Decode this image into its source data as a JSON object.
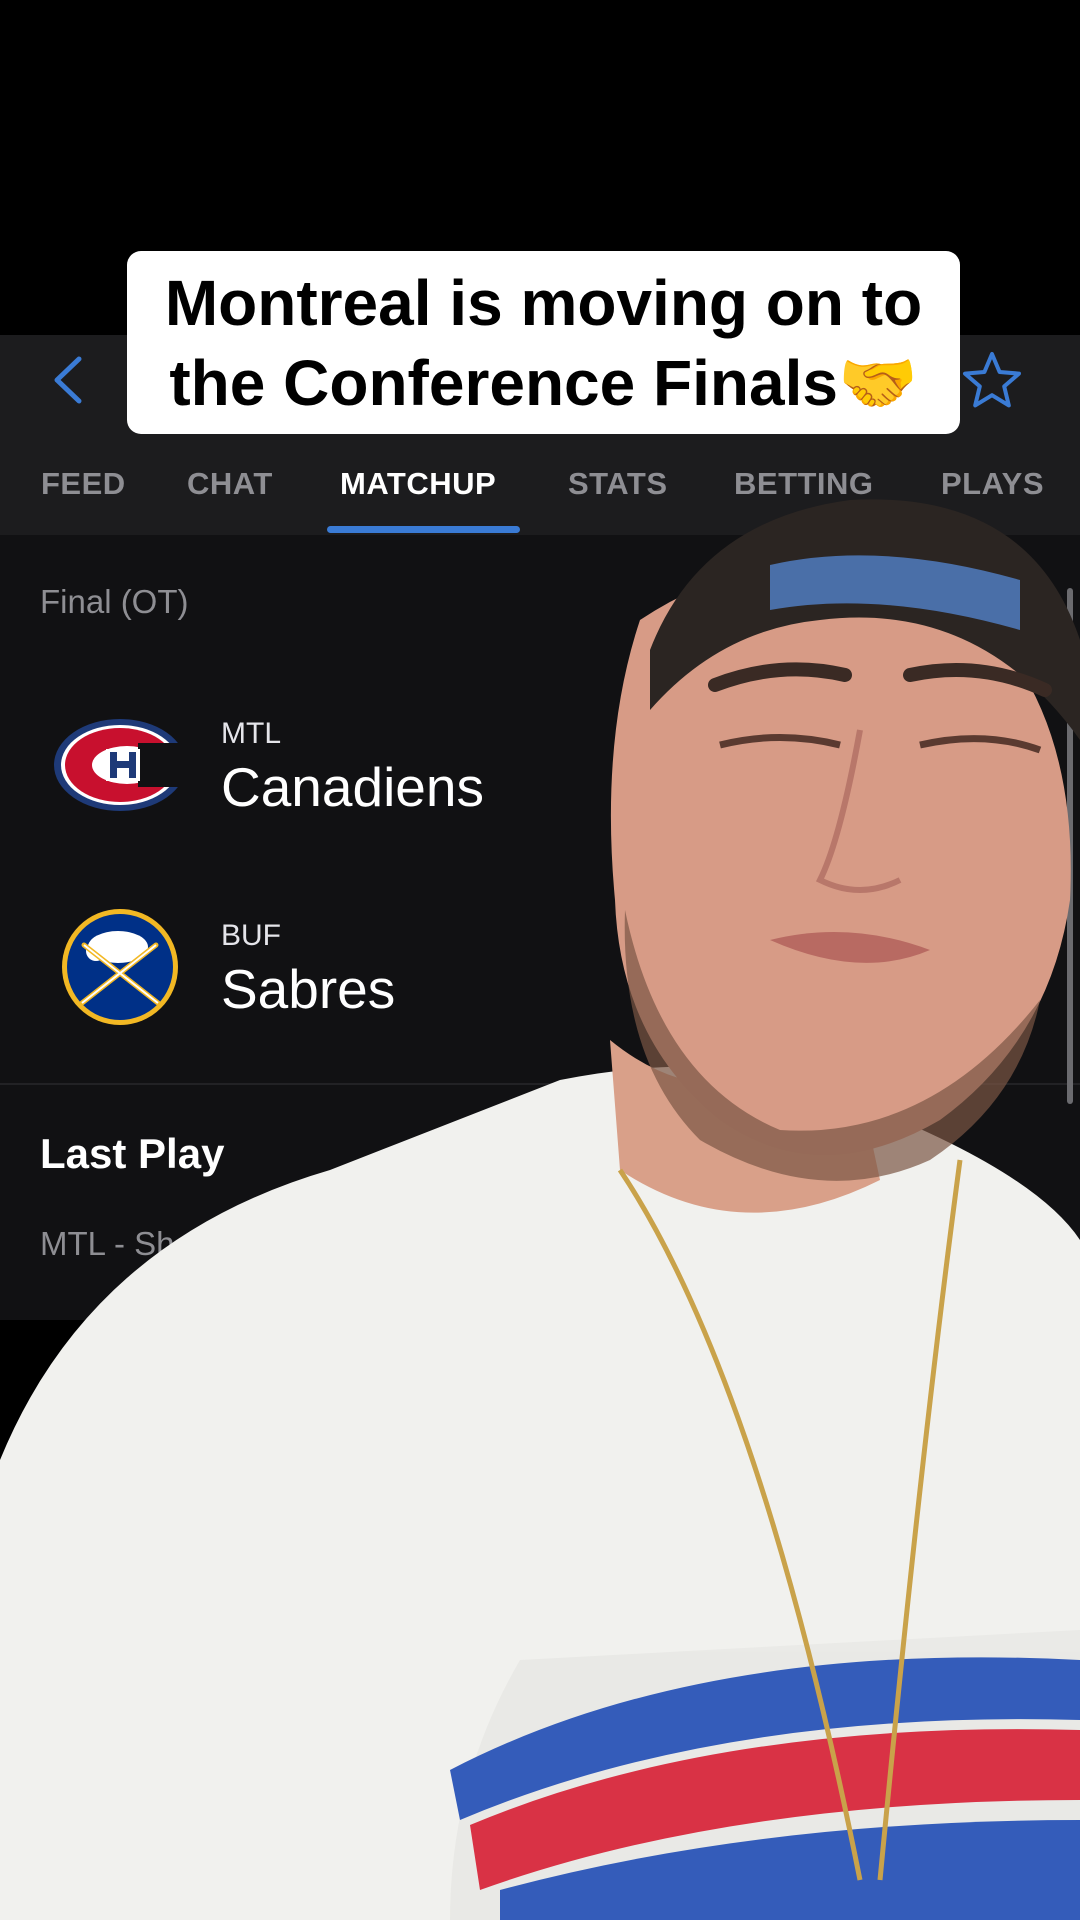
{
  "caption": {
    "line1": "Montreal is moving on to",
    "line2": "the Conference Finals🤝"
  },
  "tabs": [
    {
      "label": "FEED",
      "active": false
    },
    {
      "label": "CHAT",
      "active": false
    },
    {
      "label": "MATCHUP",
      "active": true
    },
    {
      "label": "STATS",
      "active": false
    },
    {
      "label": "BETTING",
      "active": false
    },
    {
      "label": "PLAYS",
      "active": false
    }
  ],
  "icons": {
    "back": "chevron-left-icon",
    "favorite": "star-outline-icon"
  },
  "game": {
    "status": "Final (OT)",
    "teams": [
      {
        "abbr": "MTL",
        "name": "Canadiens",
        "logo": "canadiens-logo"
      },
      {
        "abbr": "BUF",
        "name": "Sabres",
        "logo": "sabres-logo"
      }
    ]
  },
  "last_play": {
    "title": "Last Play",
    "text": "MTL - Shot on go"
  },
  "colors": {
    "accent": "#3a7bd5",
    "header_bg": "#1c1c1e",
    "content_bg": "#111113",
    "muted_text": "#8e8e93"
  }
}
